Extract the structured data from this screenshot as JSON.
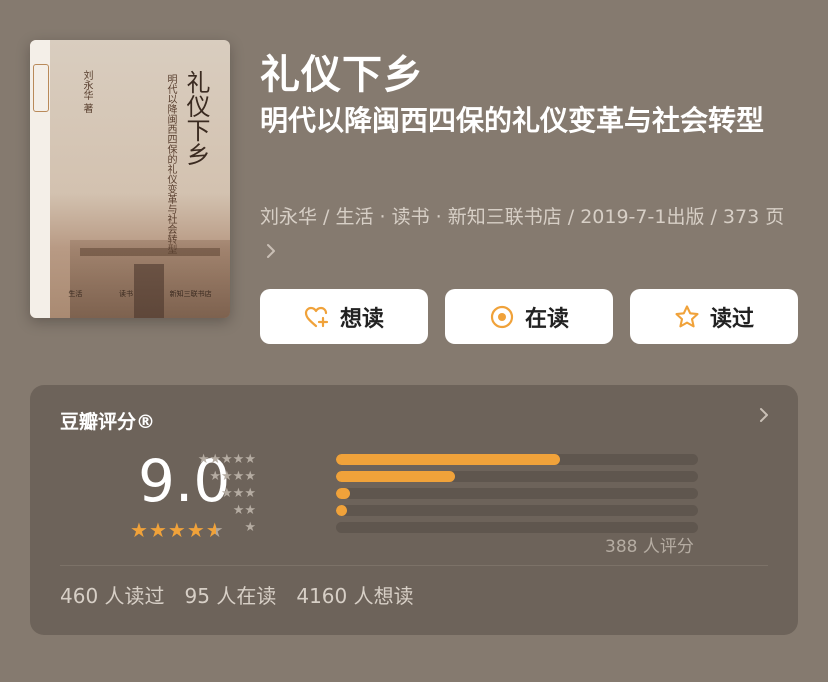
{
  "book": {
    "title": "礼仪下乡",
    "subtitle": "明代以降闽西四保的礼仪变革与社会转型",
    "meta": "刘永华 / 生活 · 读书 · 新知三联书店 / 2019-7-1出版 / 373 页",
    "cover": {
      "title": "礼仪下乡",
      "subtitle": "明代以降闽西四保的礼仪变革与社会转型",
      "author": "刘永华 著",
      "publisher_marks": [
        "生活",
        "读书",
        "新知三联书店"
      ]
    }
  },
  "actions": [
    {
      "label": "想读",
      "icon": "heart-plus-icon"
    },
    {
      "label": "在读",
      "icon": "reading-circle-icon"
    },
    {
      "label": "读过",
      "icon": "star-outline-icon"
    }
  ],
  "rating": {
    "label": "豆瓣评分®",
    "score": "9.0",
    "stars_value": 4.5,
    "distribution": [
      {
        "stars": "★★★★★",
        "fraction": 0.62
      },
      {
        "stars": "★★★★",
        "fraction": 0.33
      },
      {
        "stars": "★★★",
        "fraction": 0.04
      },
      {
        "stars": "★★",
        "fraction": 0.03
      },
      {
        "stars": "★",
        "fraction": 0.0
      }
    ],
    "count": "388 人评分"
  },
  "stats": {
    "read": "460 人读过",
    "reading": "95 人在读",
    "want": "4160 人想读"
  },
  "colors": {
    "background": "#857a6f",
    "card": "#6d635a",
    "accent": "#f0a23a"
  }
}
